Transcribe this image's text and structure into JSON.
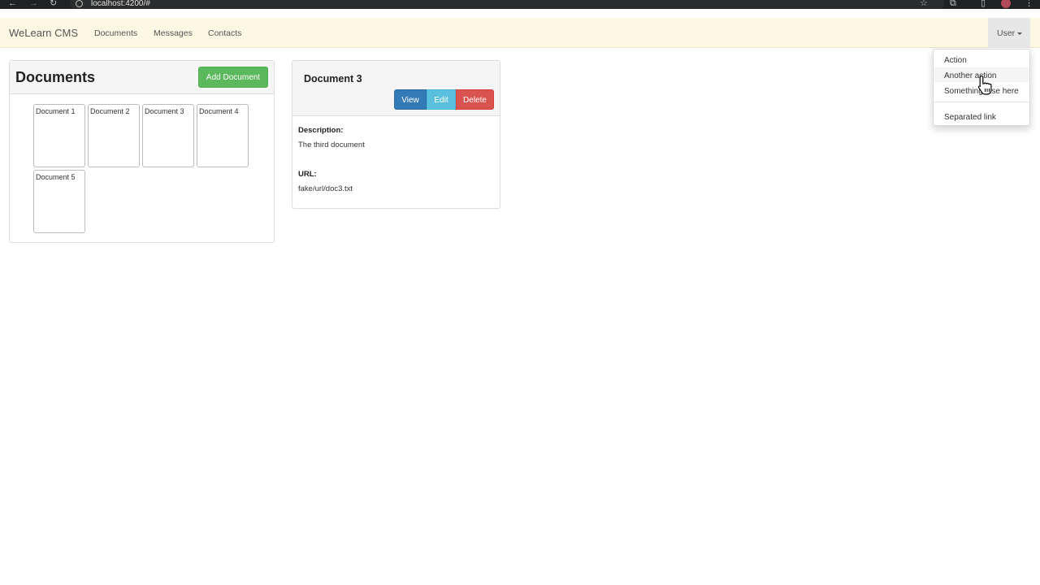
{
  "browser": {
    "url": "localhost:4200/#"
  },
  "navbar": {
    "brand": "WeLearn CMS",
    "links": [
      "Documents",
      "Messages",
      "Contacts"
    ],
    "user_label": "User"
  },
  "user_menu": {
    "items": [
      "Action",
      "Another action",
      "Something else here"
    ],
    "separated_item": "Separated link",
    "hovered_item": "Another action"
  },
  "documents_panel": {
    "title": "Documents",
    "add_button": "Add Document",
    "documents": [
      "Document 1",
      "Document 2",
      "Document 3",
      "Document 4",
      "Document 5"
    ]
  },
  "detail_panel": {
    "title": "Document 3",
    "view_button": "View",
    "edit_button": "Edit",
    "delete_button": "Delete",
    "description_label": "Description:",
    "description_value": "The third document",
    "url_label": "URL:",
    "url_value": "fake/url/doc3.txt"
  },
  "colors": {
    "navbar_bg": "#fcf8e3",
    "success": "#5cb85c",
    "primary": "#337ab7",
    "info": "#5bc0de",
    "danger": "#d9534f"
  },
  "icons": [
    "back-arrow-icon",
    "forward-arrow-icon",
    "reload-icon",
    "site-info-icon",
    "bookmark-star-icon",
    "extensions-icon",
    "side-panel-icon",
    "profile-avatar-icon",
    "more-menu-icon",
    "pointer-cursor-icon"
  ]
}
